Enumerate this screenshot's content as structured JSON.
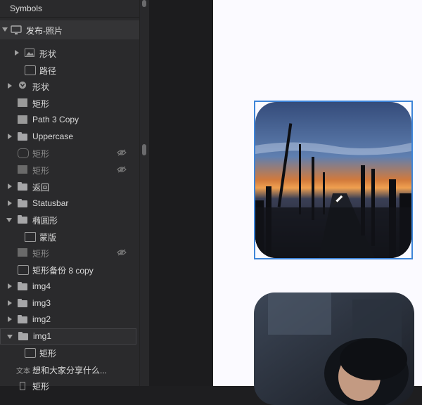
{
  "layers_panel": {
    "header": "Symbols",
    "page": "发布-照片",
    "rows": [
      {
        "label": "形状",
        "dim": false
      },
      {
        "label": "路径",
        "dim": false
      },
      {
        "label": "形状",
        "dim": false
      },
      {
        "label": "矩形",
        "dim": false
      },
      {
        "label": "Path 3 Copy",
        "dim": false
      },
      {
        "label": "Uppercase",
        "dim": false
      },
      {
        "label": "矩形",
        "dim": true
      },
      {
        "label": "矩形",
        "dim": true
      },
      {
        "label": "返回",
        "dim": false
      },
      {
        "label": "Statusbar",
        "dim": false
      },
      {
        "label": "椭圆形",
        "dim": false
      },
      {
        "label": "蒙版",
        "dim": false
      },
      {
        "label": "矩形",
        "dim": true
      },
      {
        "label": "矩形备份 8 copy",
        "dim": false
      },
      {
        "label": "img4",
        "dim": false
      },
      {
        "label": "img3",
        "dim": false
      },
      {
        "label": "img2",
        "dim": false
      },
      {
        "label": "img1",
        "dim": false
      },
      {
        "label": "矩形",
        "dim": false
      },
      {
        "label": "想和大家分享什么...",
        "dim": false
      },
      {
        "label": "矩形",
        "dim": false
      }
    ],
    "text_tag": "文本"
  },
  "colors": {
    "panel_bg": "#2a2a2c",
    "canvas_bg": "#fbfaff",
    "selection": "#3e84d8"
  },
  "icons": [
    "display-icon",
    "image-icon",
    "folder-icon",
    "checkbox-icon",
    "line-icon",
    "shape-icon",
    "hidden-eye-icon",
    "mask-icon",
    "pencil-cursor-icon"
  ]
}
